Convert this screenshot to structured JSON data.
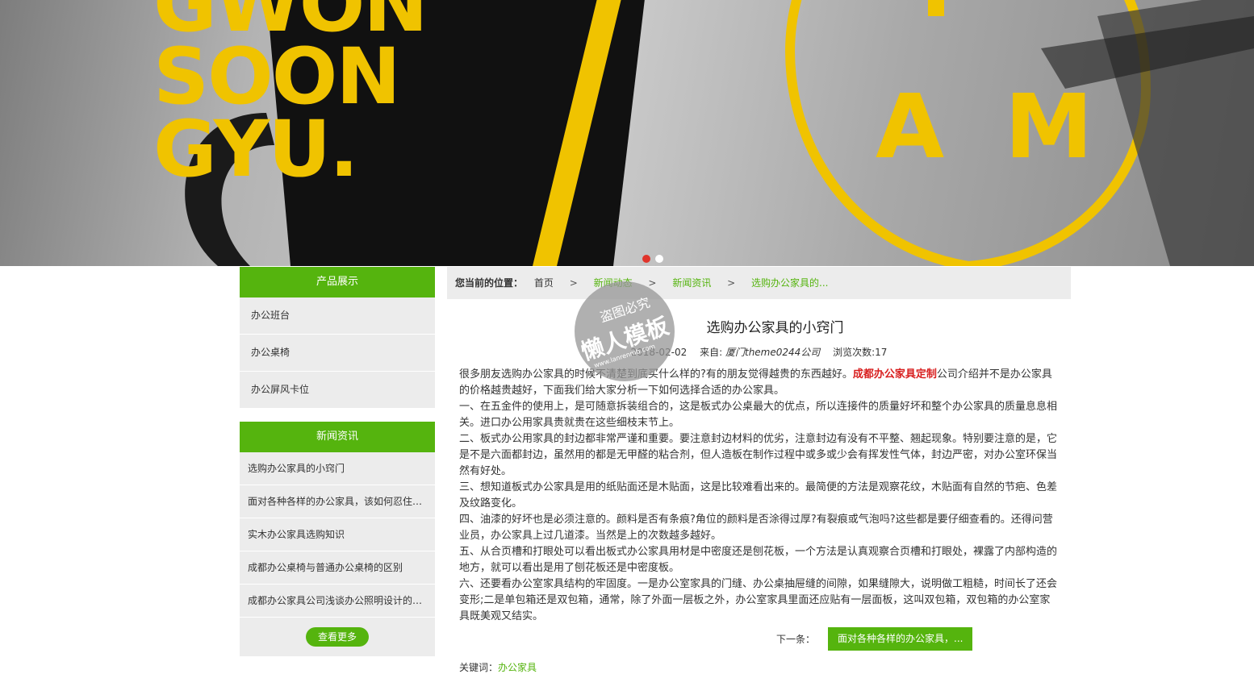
{
  "banner": {
    "lines": [
      "GWON",
      "SOON",
      "GYU."
    ],
    "badge_letters": [
      "A",
      "M"
    ],
    "accent": "#f0c300",
    "slides": 2,
    "active_slide": 1
  },
  "sidebar": {
    "products": {
      "title": "产品展示",
      "items": [
        "办公班台",
        "办公桌椅",
        "办公屏风卡位"
      ]
    },
    "news": {
      "title": "新闻资讯",
      "items": [
        "选购办公家具的小窍门",
        "面对各种各样的办公家具，该如何忍住诱惑",
        "实木办公家具选购知识",
        "成都办公桌椅与普通办公桌椅的区别",
        "成都办公家具公司浅谈办公照明设计的基本原则"
      ],
      "more_label": "查看更多"
    }
  },
  "breadcrumb": {
    "label": "您当前的位置：",
    "items": [
      "首页",
      "新闻动态",
      "新闻资讯",
      "选购办公家具的..."
    ],
    "separator": ">"
  },
  "article": {
    "title": "选购办公家具的小窍门",
    "date": "2018-02-02",
    "source_label": "来自:",
    "source": "厦门theme0244公司",
    "views": "浏览次数:17",
    "intro_before": "很多朋友选购办公家具的时候不清楚到底买什么样的?有的朋友觉得越贵的东西越好。",
    "intro_highlight": "成都办公家具定制",
    "intro_after": "公司介绍并不是办公家具的价格越贵越好，下面我们给大家分析一下如何选择合适的办公家具。",
    "paragraphs": [
      "一、在五金件的使用上，是可随意拆装组合的，这是板式办公桌最大的优点，所以连接件的质量好坏和整个办公家具的质量息息相关。进口办公用家具贵就贵在这些细枝末节上。",
      "二、板式办公用家具的封边都非常严谨和重要。要注意封边材料的优劣，注意封边有没有不平整、翘起现象。特别要注意的是，它是不是六面都封边，虽然用的都是无甲醛的粘合剂，但人造板在制作过程中或多或少会有挥发性气体，封边严密，对办公室环保当然有好处。",
      "三、想知道板式办公家具是用的纸贴面还是木贴面，这是比较难看出来的。最简便的方法是观察花纹，木贴面有自然的节疤、色差及纹路变化。",
      "四、油漆的好坏也是必须注意的。颜料是否有条痕?角位的颜料是否涂得过厚?有裂痕或气泡吗?这些都是要仔细查看的。还得问营业员，办公家具上过几道漆。当然是上的次数越多越好。",
      "五、从合页槽和打眼处可以看出板式办公家具用材是中密度还是刨花板，一个方法是认真观察合页槽和打眼处，裸露了内部构造的地方，就可以看出是用了刨花板还是中密度板。",
      "六、还要看办公室家具结构的牢固度。一是办公室家具的门缝、办公桌抽屉缝的间隙，如果缝隙大，说明做工粗糙，时间长了还会变形;二是单包箱还是双包箱，通常，除了外面一层板之外，办公室家具里面还应贴有一层面板，这叫双包箱，双包箱的办公室家具既美观又结实。"
    ],
    "next_label": "下一条：",
    "next_title": "面对各种各样的办公家具，...",
    "keywords_label": "关键词：",
    "keywords": "办公家具"
  },
  "watermark": {
    "line1": "盗图必究",
    "line2": "懒人模板",
    "line3": "www.lanrenmb.com"
  },
  "colors": {
    "accent_green": "#55b40e",
    "highlight_red": "#d81e1e",
    "gray_bg": "#ececec"
  }
}
